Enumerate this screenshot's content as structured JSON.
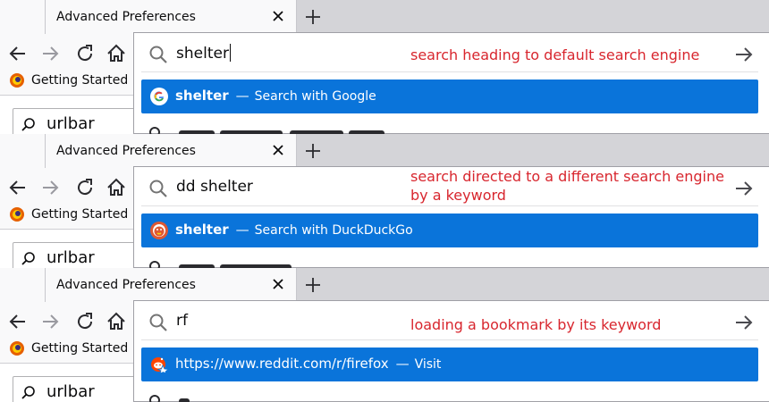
{
  "tab": {
    "title": "Advanced Preferences"
  },
  "bookmarks_toolbar": {
    "item_label": "Getting Started"
  },
  "page": {
    "search_value": "urlbar"
  },
  "panels": [
    {
      "url_value": "shelter",
      "annotation": "search heading to default search engine",
      "result": {
        "title": "shelter",
        "separator": "—",
        "action": "Search with Google",
        "icon": "google-icon"
      }
    },
    {
      "url_value": "dd shelter",
      "annotation": "search directed to a different search engine by a keyword",
      "result": {
        "title": "shelter",
        "separator": "—",
        "action": "Search with DuckDuckGo",
        "icon": "duckduckgo-icon"
      }
    },
    {
      "url_value": "rf",
      "annotation": "loading a bookmark by its keyword",
      "result": {
        "title": "https://www.reddit.com/r/firefox",
        "separator": "—",
        "action": "Visit",
        "icon": "reddit-bookmark-icon"
      }
    }
  ],
  "colors": {
    "highlight": "#0a74da",
    "annotation": "#d8262e",
    "tabstrip": "#d4d4d8"
  }
}
